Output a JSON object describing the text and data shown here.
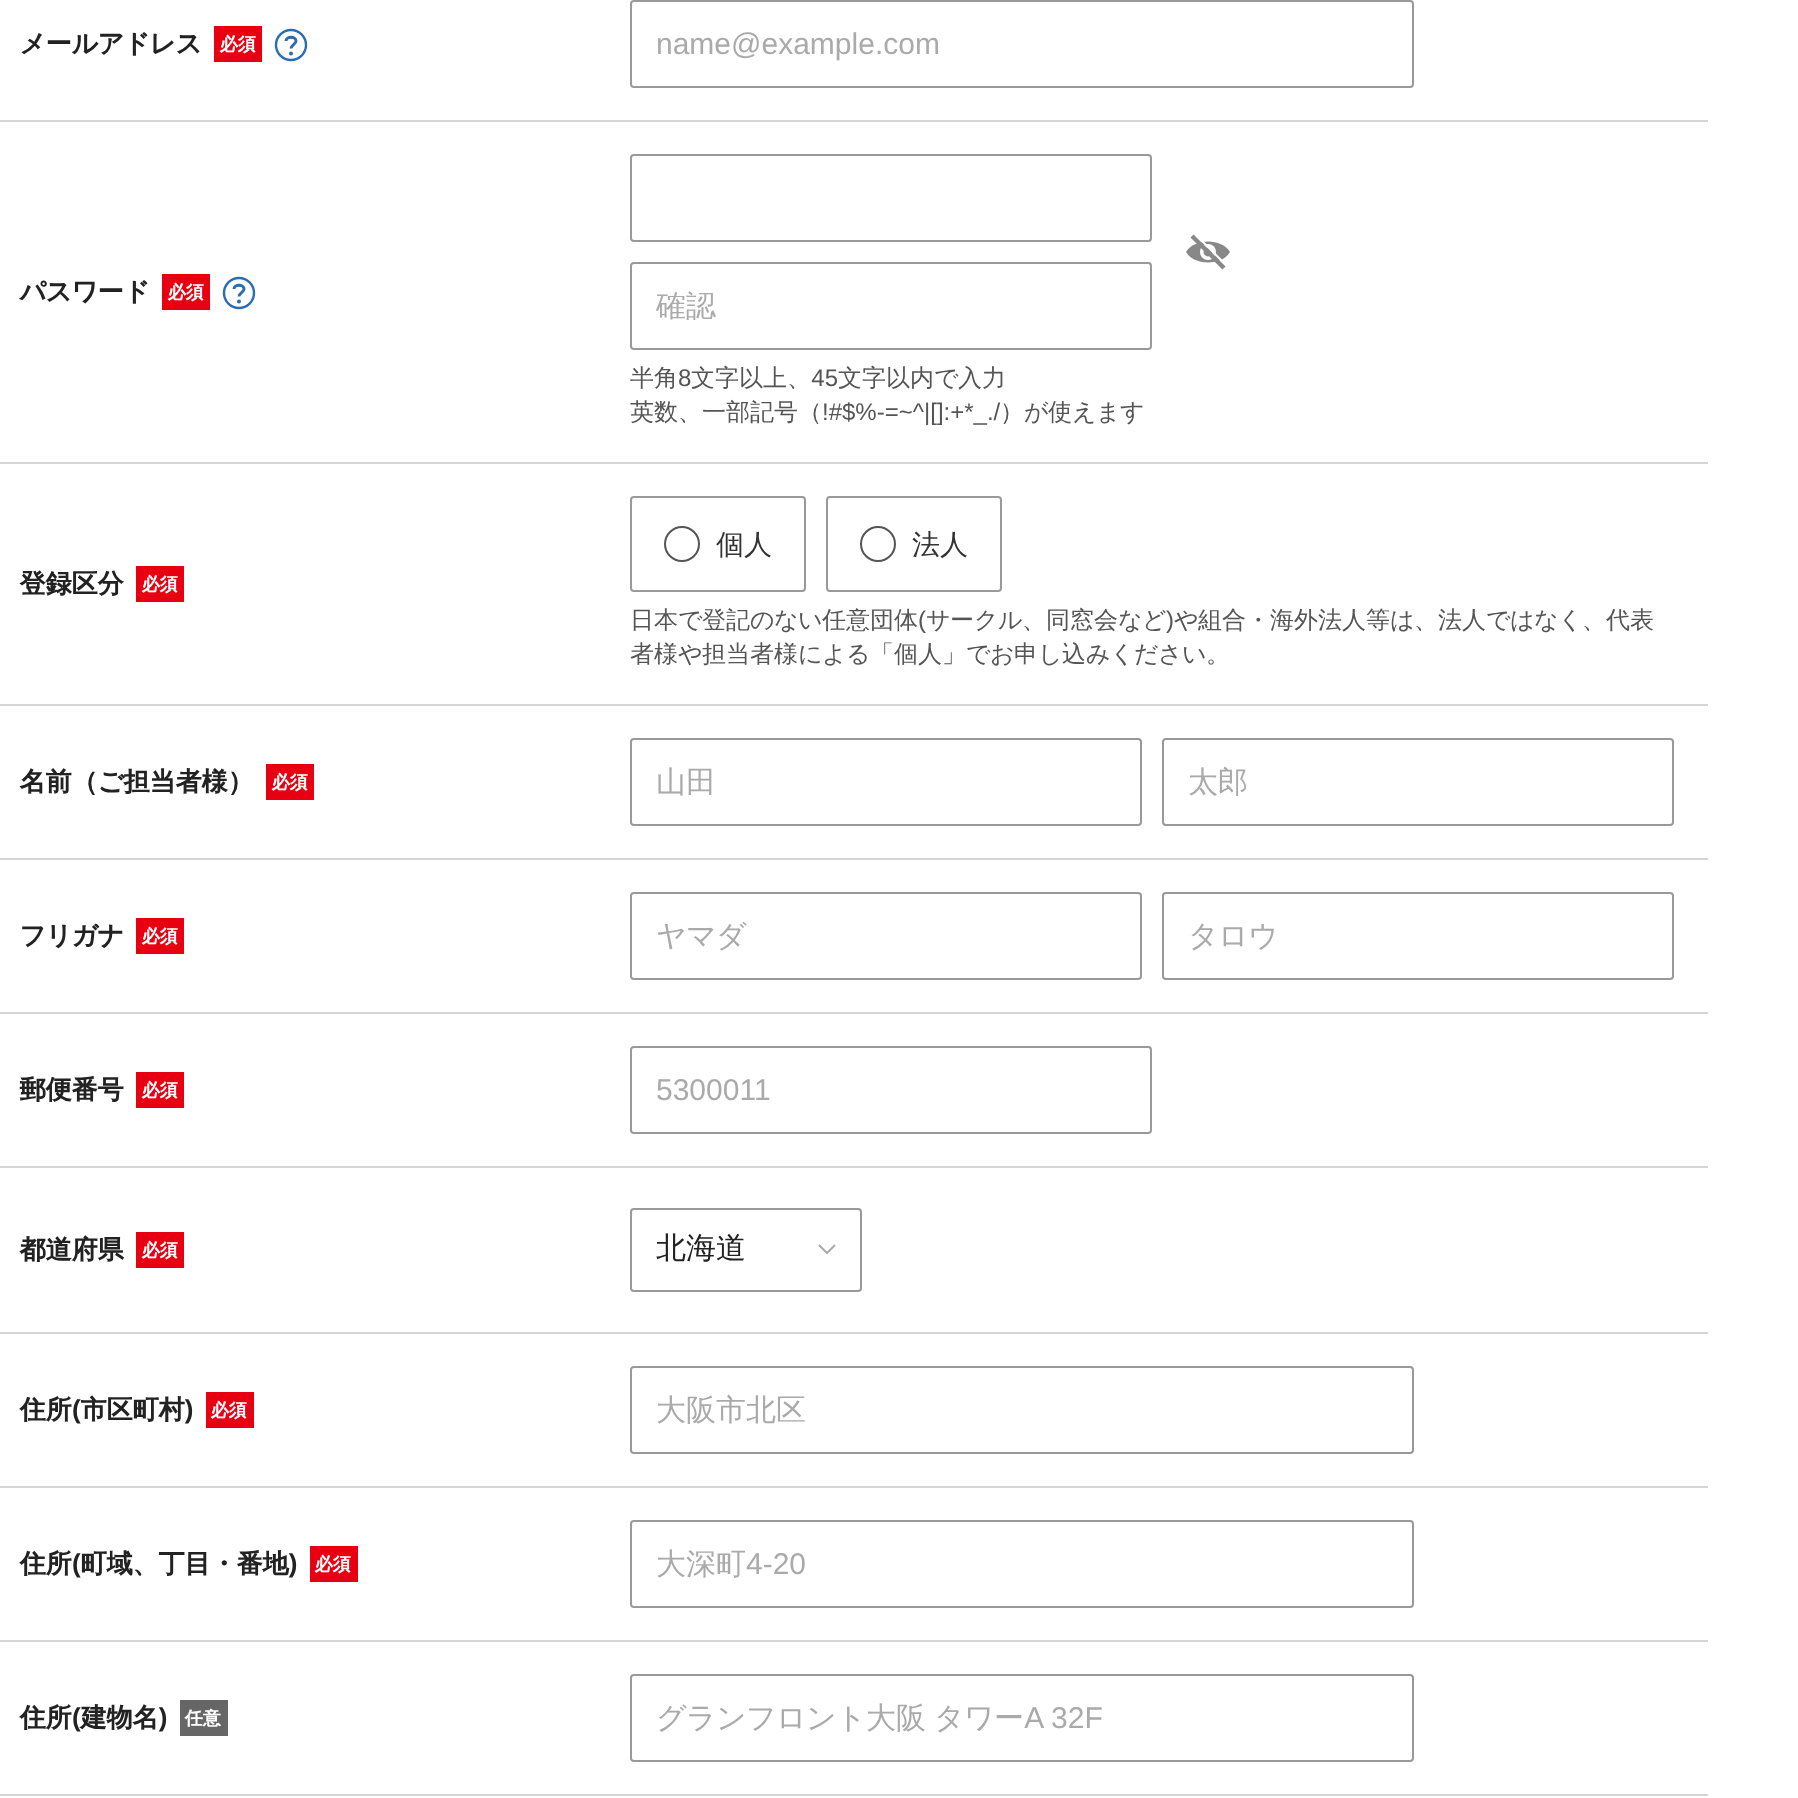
{
  "rows": [
    {
      "label": "メールアドレス",
      "badge": {
        "kind": "required",
        "text": "必須"
      },
      "help": true,
      "field": {
        "kind": "text",
        "inputs": [
          {
            "placeholder": "name@example.com"
          }
        ]
      }
    },
    {
      "label": "パスワード",
      "badge": {
        "kind": "required",
        "text": "必須"
      },
      "help": true,
      "field": {
        "kind": "password",
        "password_visible": false,
        "confirm_placeholder": "確認",
        "notes": [
          "半角8文字以上、45文字以内で入力",
          "英数、一部記号（!#$%-=~^|[]:+*_./）が使えます"
        ]
      }
    },
    {
      "label": "登録区分",
      "badge": {
        "kind": "required",
        "text": "必須"
      },
      "help": false,
      "field": {
        "kind": "radio",
        "options": [
          {
            "label": "個人",
            "selected": false
          },
          {
            "label": "法人",
            "selected": false
          }
        ],
        "notes": [
          "日本で登記のない任意団体(サークル、同窓会など)や組合・海外法人等は、法人ではなく、代表者様や担当者様による「個人」でお申し込みください。"
        ]
      }
    },
    {
      "label": "名前（ご担当者様）",
      "badge": {
        "kind": "required",
        "text": "必須"
      },
      "help": false,
      "field": {
        "kind": "pair",
        "inputs": [
          {
            "placeholder": "山田"
          },
          {
            "placeholder": "太郎"
          }
        ]
      }
    },
    {
      "label": "フリガナ",
      "badge": {
        "kind": "required",
        "text": "必須"
      },
      "help": false,
      "field": {
        "kind": "pair",
        "inputs": [
          {
            "placeholder": "ヤマダ"
          },
          {
            "placeholder": "タロウ"
          }
        ]
      }
    },
    {
      "label": "郵便番号",
      "badge": {
        "kind": "required",
        "text": "必須"
      },
      "help": false,
      "field": {
        "kind": "short_text",
        "inputs": [
          {
            "placeholder": "5300011"
          }
        ]
      }
    },
    {
      "label": "都道府県",
      "badge": {
        "kind": "required",
        "text": "必須"
      },
      "help": false,
      "field": {
        "kind": "select",
        "value": "北海道"
      }
    },
    {
      "label": "住所(市区町村)",
      "badge": {
        "kind": "required",
        "text": "必須"
      },
      "help": false,
      "field": {
        "kind": "text",
        "inputs": [
          {
            "placeholder": "大阪市北区"
          }
        ]
      }
    },
    {
      "label": "住所(町域、丁目・番地)",
      "badge": {
        "kind": "required",
        "text": "必須"
      },
      "help": false,
      "field": {
        "kind": "text",
        "inputs": [
          {
            "placeholder": "大深町4-20"
          }
        ]
      }
    },
    {
      "label": "住所(建物名)",
      "badge": {
        "kind": "optional",
        "text": "任意"
      },
      "help": false,
      "field": {
        "kind": "text",
        "inputs": [
          {
            "placeholder": "グランフロント大阪 タワーA 32F"
          }
        ]
      }
    }
  ]
}
